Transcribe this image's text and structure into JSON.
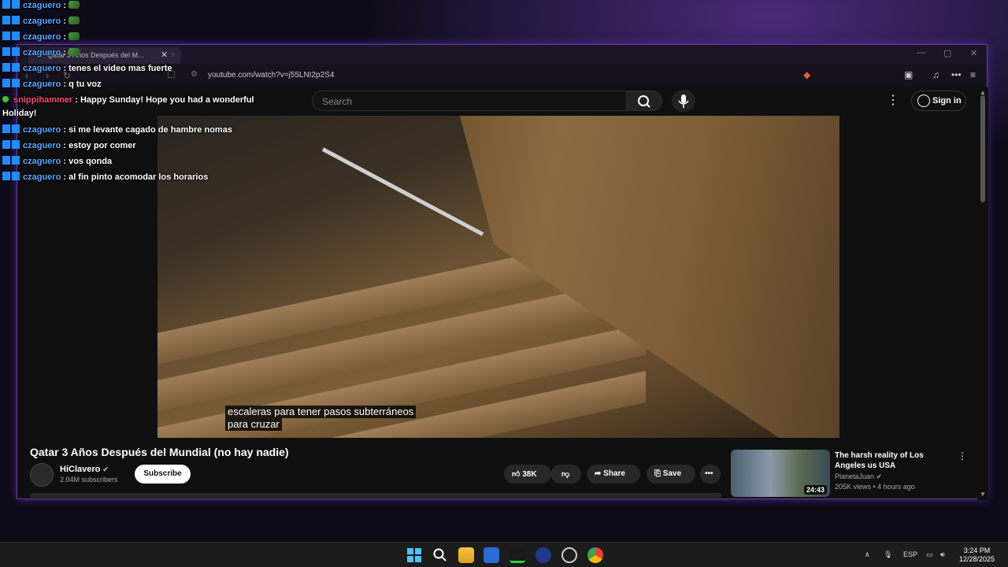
{
  "browser": {
    "tab_title": "Qatar 3 Años Después del M...",
    "url": "youtube.com/watch?v=j55LNI2p2S4"
  },
  "youtube": {
    "search_placeholder": "Search",
    "sign_in": "Sign in"
  },
  "video": {
    "subtitle_line1": "escaleras para tener pasos subterráneos",
    "subtitle_line2": "para cruzar",
    "title": "Qatar 3 Años Después del Mundial (no hay nadie)",
    "channel": "HiClavero",
    "subscribers": "2.04M subscribers",
    "subscribe_label": "Subscribe",
    "likes": "38K",
    "share_label": "Share",
    "save_label": "Save"
  },
  "recommended": {
    "title": "The harsh reality of Los Angeles us USA",
    "channel": "PlanetaJuan",
    "meta": "205K views • 4 hours ago",
    "duration": "24:43"
  },
  "chat": {
    "messages": [
      {
        "user": "czaguero",
        "text": ""
      },
      {
        "user": "czaguero",
        "text": ""
      },
      {
        "user": "czaguero",
        "text": ""
      },
      {
        "user": "czaguero",
        "text": ""
      },
      {
        "user": "czaguero",
        "text": "tenes el video mas fuerte"
      },
      {
        "user": "czaguero",
        "text": "q tu voz"
      },
      {
        "user": "snippihammer",
        "text": "Happy Sunday! Hope you had a wonderful",
        "text2": "Holiday!"
      },
      {
        "user": "czaguero",
        "text": "si me levante cagado de hambre nomas"
      },
      {
        "user": "czaguero",
        "text": "estoy por comer"
      },
      {
        "user": "czaguero",
        "text": "vos qonda"
      },
      {
        "user": "czaguero",
        "text": "al fin pinto acomodar los horarios"
      }
    ]
  },
  "taskbar": {
    "language": "ESP",
    "time": "3:24 PM",
    "date": "12/28/2025"
  },
  "colors": {
    "accent_border": "#6b3aa8",
    "chat_user": "#5aa8ff",
    "chat_user_alt": "#ff4a7a"
  }
}
